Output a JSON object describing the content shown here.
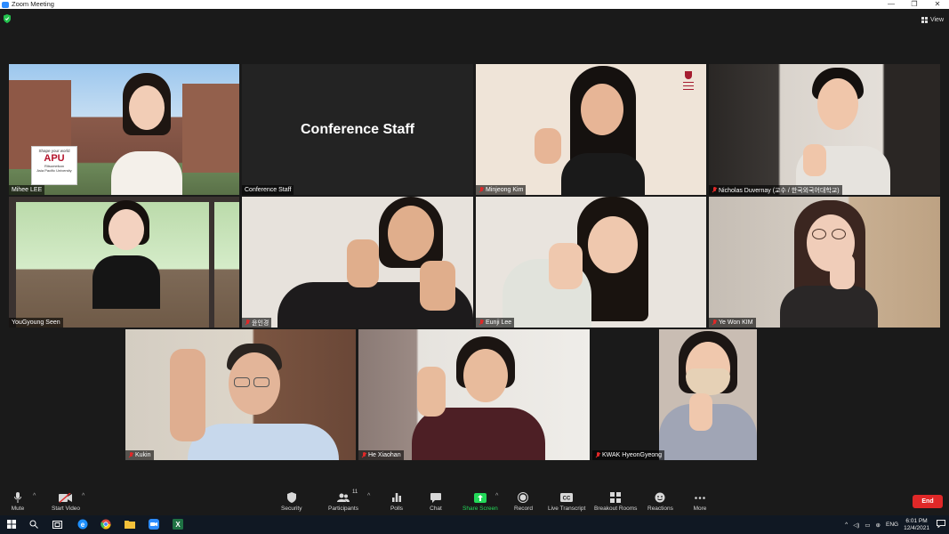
{
  "window": {
    "title": "Zoom Meeting",
    "controls": [
      "—",
      "❐",
      "✕"
    ]
  },
  "meeting": {
    "view_label": "View"
  },
  "tiles": [
    {
      "name": "Mihee LEE",
      "muted": false,
      "sign_line1": "Shape your world",
      "sign_logo": "APU",
      "sign_line2": "Ritsumeikan",
      "sign_line3": "Asia Pacific University"
    },
    {
      "name": "Conference Staff",
      "muted": false,
      "display_name": "Conference Staff",
      "active_speaker": true
    },
    {
      "name": "Minjeong Kim",
      "muted": true
    },
    {
      "name": "Nicholas Duvernay (교수 / 한국외국어대학교)",
      "muted": true
    },
    {
      "name": "YouGyoung Seen",
      "muted": false
    },
    {
      "name": "윤인경",
      "muted": true
    },
    {
      "name": "Eunji Lee",
      "muted": true
    },
    {
      "name": "Ye Won KIM",
      "muted": true
    },
    {
      "name": "Kukin",
      "muted": true
    },
    {
      "name": "He Xiaohan",
      "muted": true
    },
    {
      "name": "KWAK HyeonGyeong",
      "muted": true
    }
  ],
  "toolbar": {
    "mute": "Mute",
    "start_video": "Start Video",
    "security": "Security",
    "participants": "Participants",
    "participants_count": "11",
    "polls": "Polls",
    "chat": "Chat",
    "share_screen": "Share Screen",
    "record": "Record",
    "live_transcript": "Live Transcript",
    "breakout_rooms": "Breakout Rooms",
    "reactions": "Reactions",
    "more": "More",
    "end": "End",
    "share_color": "#23d959",
    "end_color": "#e02828"
  },
  "taskbar": {
    "language": "ENG",
    "time": "6:01 PM",
    "date": "12/4/2021"
  }
}
